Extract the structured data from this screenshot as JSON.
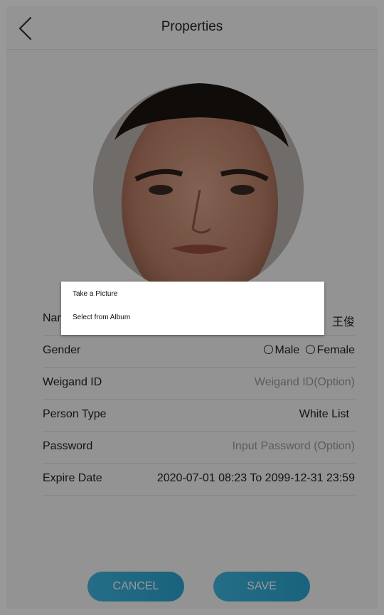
{
  "header": {
    "title": "Properties"
  },
  "form": {
    "rows": [
      {
        "label": "Name",
        "value": "王俊"
      },
      {
        "label": "Gender",
        "options": [
          "Male",
          "Female"
        ]
      },
      {
        "label": "Weigand ID",
        "placeholder": "Weigand ID(Option)"
      },
      {
        "label": "Person Type",
        "value": "White List"
      },
      {
        "label": "Password",
        "placeholder": "Input Password (Option)"
      },
      {
        "label": "Expire Date",
        "value": "2020-07-01 08:23 To 2099-12-31 23:59"
      }
    ]
  },
  "buttons": {
    "cancel": "CANCEL",
    "save": "SAVE"
  },
  "dialog": {
    "items": [
      "Take a Picture",
      "Select from Album"
    ]
  },
  "icons": {
    "back": "chevron-left-icon"
  },
  "colors": {
    "accent": "#2aa5d1",
    "overlay": "rgba(0,0,0,0.40)"
  }
}
